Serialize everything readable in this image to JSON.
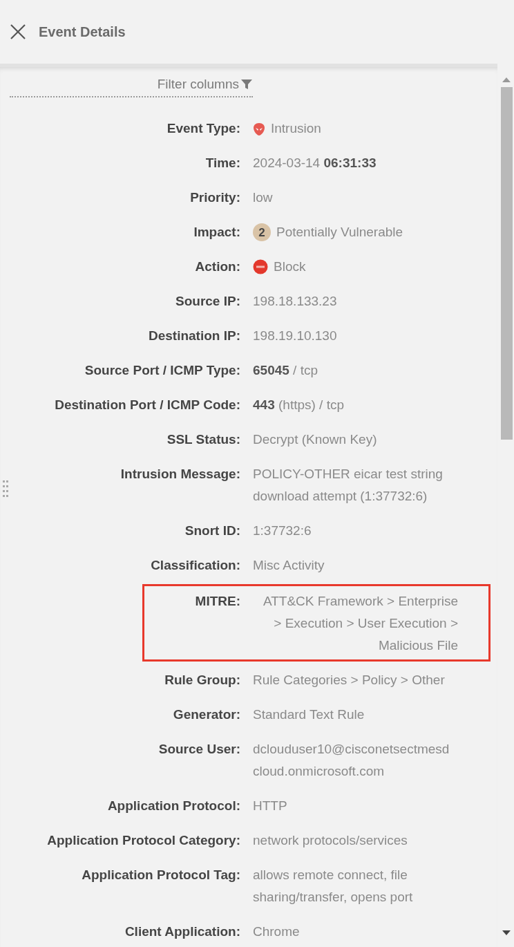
{
  "header": {
    "title": "Event Details"
  },
  "filter": {
    "label": "Filter columns"
  },
  "rows": [
    {
      "label": "Event Type:",
      "value": "Intrusion",
      "kind": "intrusion"
    },
    {
      "label": "Time:",
      "value": "2024-03-14 **06:31:33**"
    },
    {
      "label": "Priority:",
      "value": "low"
    },
    {
      "label": "Impact:",
      "value": "Potentially Vulnerable",
      "kind": "impact",
      "badge": "2"
    },
    {
      "label": "Action:",
      "value": "Block",
      "kind": "block"
    },
    {
      "label": "Source IP:",
      "value": "198.18.133.23"
    },
    {
      "label": "Destination IP:",
      "value": "198.19.10.130"
    },
    {
      "label": "Source Port / ICMP Type:",
      "value": "**65045** / tcp"
    },
    {
      "label": "Destination Port / ICMP Code:",
      "value": "**443** (https) / tcp"
    },
    {
      "label": "SSL Status:",
      "value": "Decrypt (Known Key)"
    },
    {
      "label": "Intrusion Message:",
      "value": "POLICY-OTHER eicar test string download attempt (1:37732:6)"
    },
    {
      "label": "Snort ID:",
      "value": "1:37732:6"
    },
    {
      "label": "Classification:",
      "value": "Misc Activity"
    },
    {
      "label": "MITRE:",
      "value": "ATT&CK Framework > Enterprise > Execution > User Execution > Malicious File",
      "highlighted": true
    },
    {
      "label": "Rule Group:",
      "value": "Rule Categories > Policy > Other"
    },
    {
      "label": "Generator:",
      "value": "Standard Text Rule"
    },
    {
      "label": "Source User:",
      "value": "dclouduser10@cisconetsectmesdcloud.onmicrosoft.com"
    },
    {
      "label": "Application Protocol:",
      "value": "HTTP"
    },
    {
      "label": "Application Protocol Category:",
      "value": "network protocols/services"
    },
    {
      "label": "Application Protocol Tag:",
      "value": "allows remote connect, file sharing/transfer, opens port"
    },
    {
      "label": "Client Application:",
      "value": "Chrome"
    }
  ]
}
